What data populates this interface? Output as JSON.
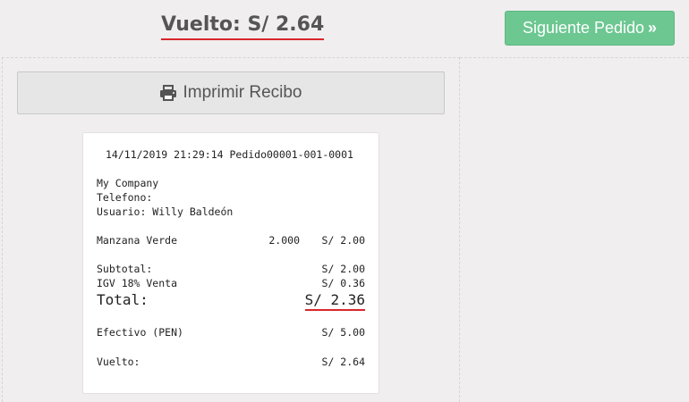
{
  "header": {
    "change_label": "Vuelto: S/ 2.64",
    "next_order_label": "Siguiente Pedido",
    "next_order_icon": "double-chevron-right-icon"
  },
  "actions": {
    "print_label": "Imprimir Recibo",
    "print_icon": "printer-icon"
  },
  "receipt": {
    "header_line": "14/11/2019 21:29:14 Pedido00001-001-0001",
    "company": "My Company",
    "phone_label": "Telefono:",
    "user_line": "Usuario: Willy Baldeón",
    "items": [
      {
        "name": "Manzana Verde",
        "qty": "2.000",
        "price": "S/ 2.00"
      }
    ],
    "subtotal_label": "Subtotal:",
    "subtotal_value": "S/ 2.00",
    "tax_label": "IGV 18% Venta",
    "tax_value": "S/ 0.36",
    "total_label": "Total:",
    "total_value": "S/ 2.36",
    "cash_label": "Efectivo (PEN)",
    "cash_value": "S/ 5.00",
    "change_label": "Vuelto:",
    "change_value": "S/ 2.64"
  },
  "colors": {
    "accent_green": "#6cc791",
    "underline_red": "#d8262c",
    "background": "#f0eeef"
  }
}
